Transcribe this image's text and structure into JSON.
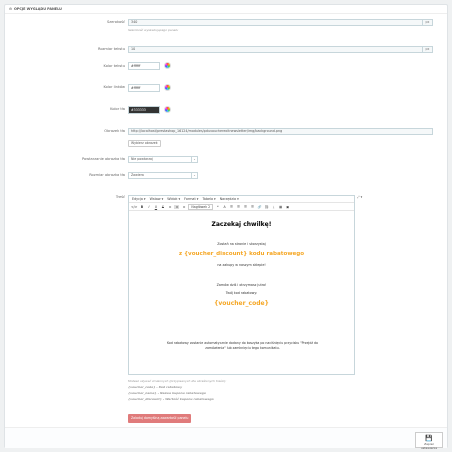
{
  "panel": {
    "title": "OPCJE WYGLĄDU PANELU"
  },
  "fields": {
    "opacity": {
      "label": "Szerokość",
      "value": "340",
      "unit": "px",
      "help": "Szerokość wyskakującego panelu"
    },
    "font_size": {
      "label": "Rozmiar tekstu",
      "value": "10",
      "unit": "px"
    },
    "text_color": {
      "label": "Kolor tekstu",
      "value": "#ffffff"
    },
    "link_color": {
      "label": "Kolor linków",
      "value": "#ffffff"
    },
    "bg_color": {
      "label": "Kolor tła",
      "value": "#333333"
    },
    "bg_image": {
      "label": "Obrazek tła",
      "value": "http://localhost/prestashop_16124/modules/pduvoucherexitnewsletter/img/background.png",
      "button": "Wybierz obrazek"
    },
    "bg_repeat": {
      "label": "Powtarzanie obrazka tła",
      "value": "Nie powtarzaj"
    },
    "bg_size": {
      "label": "Rozmiar obrazka tła",
      "value": "Zawiera"
    },
    "content": {
      "label": "Treść"
    }
  },
  "editor": {
    "menu": [
      "Edycja ▾",
      "Wstaw ▾",
      "Widok ▾",
      "Format ▾",
      "Tabela ▾",
      "Narzędzia ▾"
    ],
    "toolbar": [
      "</>",
      "B",
      "I",
      "U",
      "S",
      "≡",
      "≡",
      "≡"
    ],
    "heading_select": "Nagłówek 2",
    "toolbar2": [
      "❝",
      "A",
      "☰",
      "☰",
      "☰",
      "☰",
      "🔗",
      "⛓",
      "⤓",
      "▦",
      "▣"
    ],
    "expand": "⤢ ▾",
    "heading": "Zaczekaj chwilkę!",
    "line1": "Zostań na stronie i skorzystaj",
    "voucher_line": "z {voucher_discount} kodu rabatowego",
    "line2": "na zakupy w naszym sklepie!",
    "line3": "Zamów dziś i otrzymasz jutro!",
    "line4": "Twój kod rabatowy:",
    "code": "{voucher_code}",
    "footer_text": "Kod rabatowy zostanie automatycznie dodany do koszyka po naciśnięciu przycisku \"Przejdź do zamówienia\" lub zamknięciu tego komunikatu."
  },
  "vars_help": {
    "intro": "Możesz używać zmiennych (przypisanych dla określonych treści):",
    "items": [
      "{voucher_code} - Kod rabatowy",
      "{voucher_name} - Nazwa kuponu rabatowego",
      "{voucher_discount} - Wartość kuponu rabatowego"
    ]
  },
  "buttons": {
    "reset": "Zaladuj domyślną zawartość panelu",
    "save": "Zapisz ustawienia"
  },
  "colors": {
    "accent_orange": "#f5a623",
    "reset_red": "#e07b7b"
  }
}
